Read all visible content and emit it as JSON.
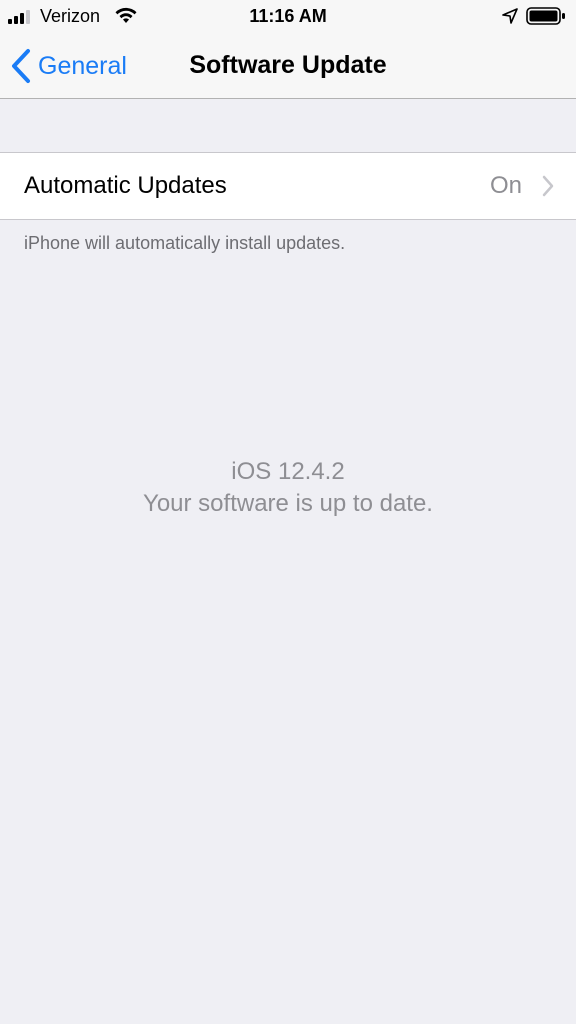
{
  "status_bar": {
    "carrier": "Verizon",
    "time": "11:16 AM",
    "icons": [
      "signal-icon",
      "wifi-icon",
      "location-icon",
      "battery-icon"
    ]
  },
  "nav": {
    "back_label": "General",
    "title": "Software Update",
    "accent_color": "#1a7cf6"
  },
  "settings": {
    "automatic_updates": {
      "label": "Automatic Updates",
      "value": "On"
    },
    "footer_note": "iPhone will automatically install updates."
  },
  "software": {
    "version": "iOS 12.4.2",
    "status": "Your software is up to date."
  }
}
